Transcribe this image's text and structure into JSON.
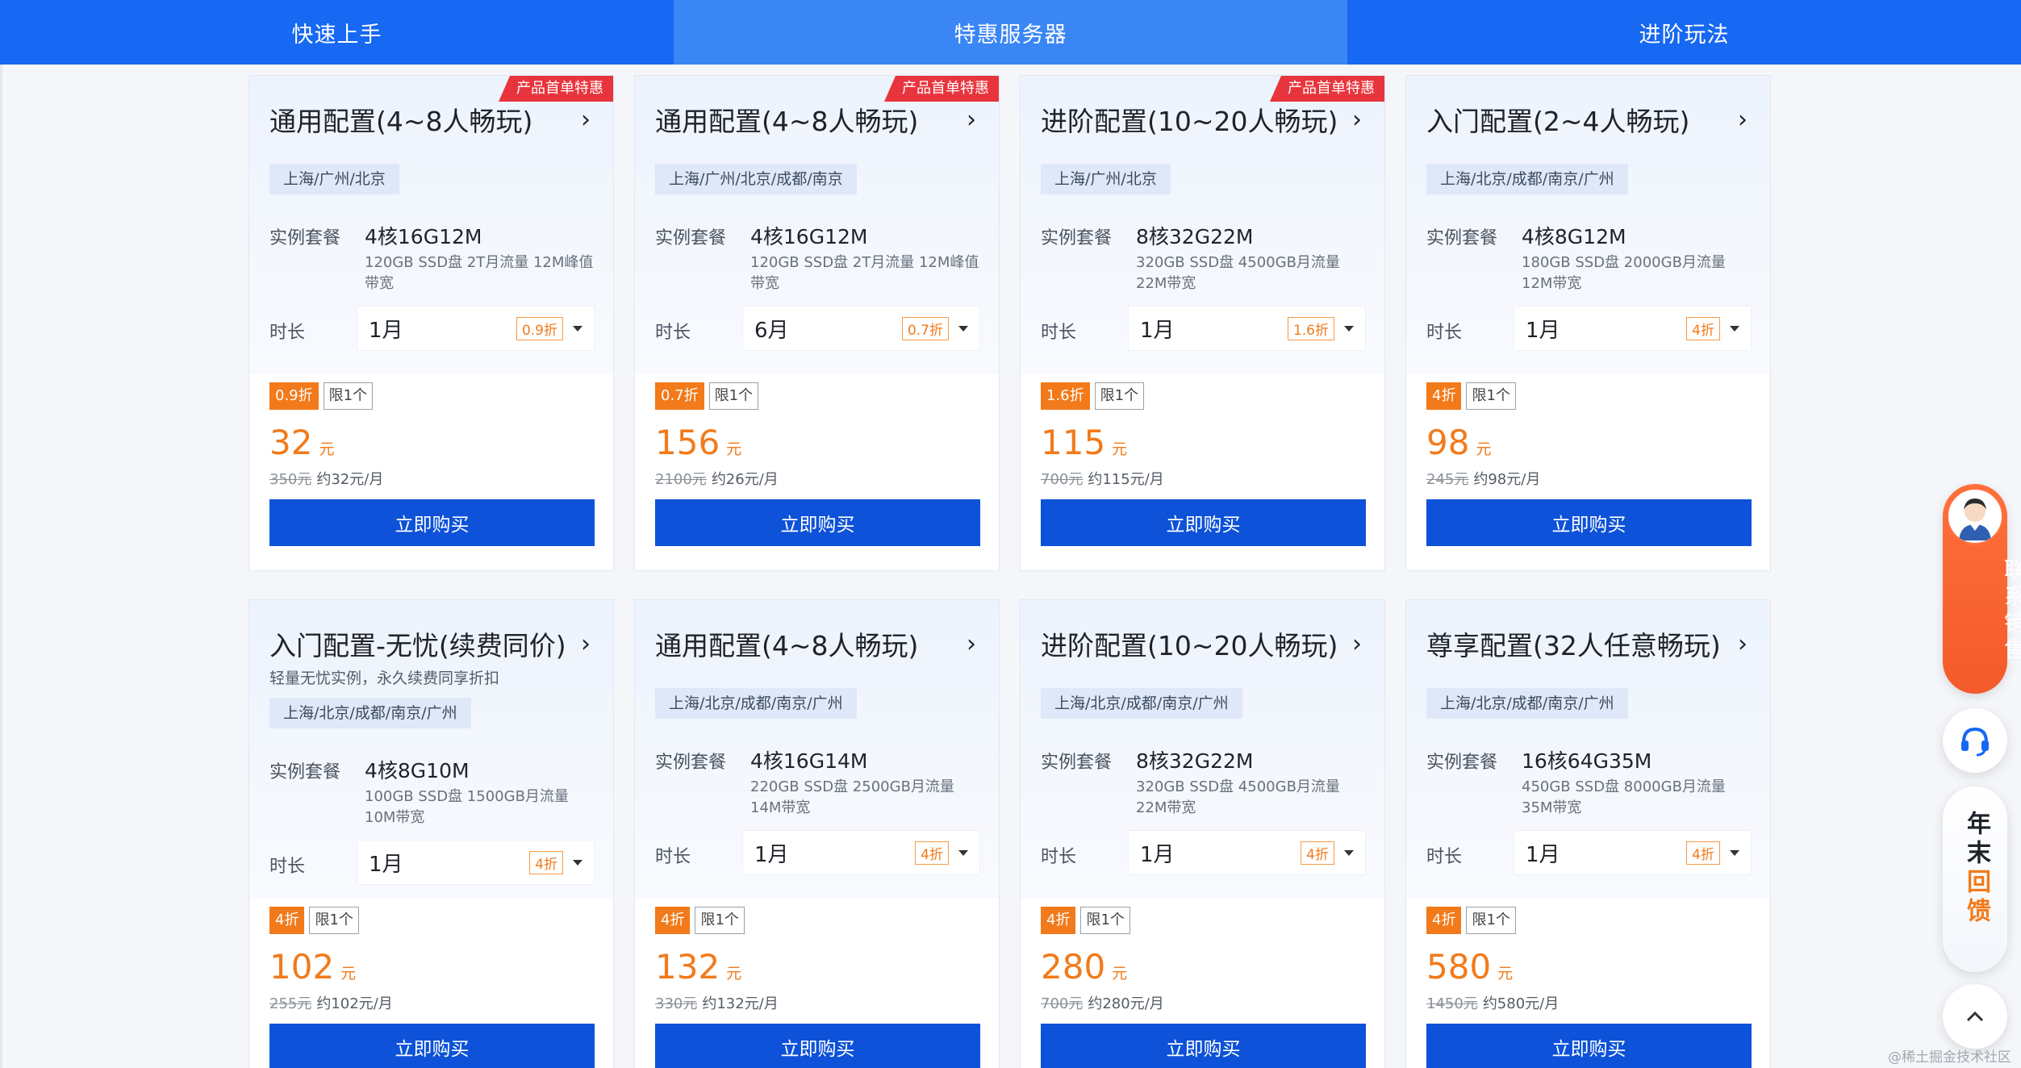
{
  "nav": {
    "tabs": [
      {
        "label": "快速上手",
        "active": false
      },
      {
        "label": "特惠服务器",
        "active": true
      },
      {
        "label": "进阶玩法",
        "active": false
      }
    ]
  },
  "cards": [
    {
      "ribbon": "产品首单特惠",
      "title": "通用配置(4~8人畅玩)",
      "subtitle": "",
      "region": "上海/广州/北京",
      "pkg_label": "实例套餐",
      "pkg": "4核16G12M",
      "desc": "120GB SSD盘 2T月流量 12M峰值带宽",
      "dur_label": "时长",
      "duration": "1月",
      "discount": "0.9折",
      "limit": "限1个",
      "price": "32",
      "unit": "元",
      "orig": "350元",
      "monthly": "约32元/月",
      "buy": "立即购买"
    },
    {
      "ribbon": "产品首单特惠",
      "title": "通用配置(4~8人畅玩)",
      "subtitle": "",
      "region": "上海/广州/北京/成都/南京",
      "pkg_label": "实例套餐",
      "pkg": "4核16G12M",
      "desc": "120GB SSD盘 2T月流量 12M峰值带宽",
      "dur_label": "时长",
      "duration": "6月",
      "discount": "0.7折",
      "limit": "限1个",
      "price": "156",
      "unit": "元",
      "orig": "2100元",
      "monthly": "约26元/月",
      "buy": "立即购买"
    },
    {
      "ribbon": "产品首单特惠",
      "title": "进阶配置(10~20人畅玩)",
      "subtitle": "",
      "region": "上海/广州/北京",
      "pkg_label": "实例套餐",
      "pkg": "8核32G22M",
      "desc": "320GB SSD盘 4500GB月流量 22M带宽",
      "dur_label": "时长",
      "duration": "1月",
      "discount": "1.6折",
      "limit": "限1个",
      "price": "115",
      "unit": "元",
      "orig": "700元",
      "monthly": "约115元/月",
      "buy": "立即购买"
    },
    {
      "ribbon": "",
      "title": "入门配置(2~4人畅玩)",
      "subtitle": "",
      "region": "上海/北京/成都/南京/广州",
      "pkg_label": "实例套餐",
      "pkg": "4核8G12M",
      "desc": "180GB SSD盘 2000GB月流量 12M带宽",
      "dur_label": "时长",
      "duration": "1月",
      "discount": "4折",
      "limit": "限1个",
      "price": "98",
      "unit": "元",
      "orig": "245元",
      "monthly": "约98元/月",
      "buy": "立即购买"
    },
    {
      "ribbon": "",
      "title": "入门配置-无忧(续费同价)",
      "subtitle": "轻量无忧实例，永久续费同享折扣",
      "region": "上海/北京/成都/南京/广州",
      "pkg_label": "实例套餐",
      "pkg": "4核8G10M",
      "desc": "100GB SSD盘 1500GB月流量 10M带宽",
      "dur_label": "时长",
      "duration": "1月",
      "discount": "4折",
      "limit": "限1个",
      "price": "102",
      "unit": "元",
      "orig": "255元",
      "monthly": "约102元/月",
      "buy": "立即购买"
    },
    {
      "ribbon": "",
      "title": "通用配置(4~8人畅玩)",
      "subtitle": "",
      "region": "上海/北京/成都/南京/广州",
      "pkg_label": "实例套餐",
      "pkg": "4核16G14M",
      "desc": "220GB SSD盘 2500GB月流量 14M带宽",
      "dur_label": "时长",
      "duration": "1月",
      "discount": "4折",
      "limit": "限1个",
      "price": "132",
      "unit": "元",
      "orig": "330元",
      "monthly": "约132元/月",
      "buy": "立即购买"
    },
    {
      "ribbon": "",
      "title": "进阶配置(10~20人畅玩)",
      "subtitle": "",
      "region": "上海/北京/成都/南京/广州",
      "pkg_label": "实例套餐",
      "pkg": "8核32G22M",
      "desc": "320GB SSD盘 4500GB月流量 22M带宽",
      "dur_label": "时长",
      "duration": "1月",
      "discount": "4折",
      "limit": "限1个",
      "price": "280",
      "unit": "元",
      "orig": "700元",
      "monthly": "约280元/月",
      "buy": "立即购买"
    },
    {
      "ribbon": "",
      "title": "尊享配置(32人任意畅玩)",
      "subtitle": "",
      "region": "上海/北京/成都/南京/广州",
      "pkg_label": "实例套餐",
      "pkg": "16核64G35M",
      "desc": "450GB SSD盘 8000GB月流量 35M带宽",
      "dur_label": "时长",
      "duration": "1月",
      "discount": "4折",
      "limit": "限1个",
      "price": "580",
      "unit": "元",
      "orig": "1450元",
      "monthly": "约580元/月",
      "buy": "立即购买"
    }
  ],
  "widgets": {
    "sales": "联系销售",
    "feedback_a": "年末",
    "feedback_b": "回馈"
  },
  "watermark": "@稀土掘金技术社区",
  "colors": {
    "nav": "#1768f2",
    "accent": "#f27a1a",
    "buy": "#0d52d8",
    "ribbon": "#e8343c"
  }
}
